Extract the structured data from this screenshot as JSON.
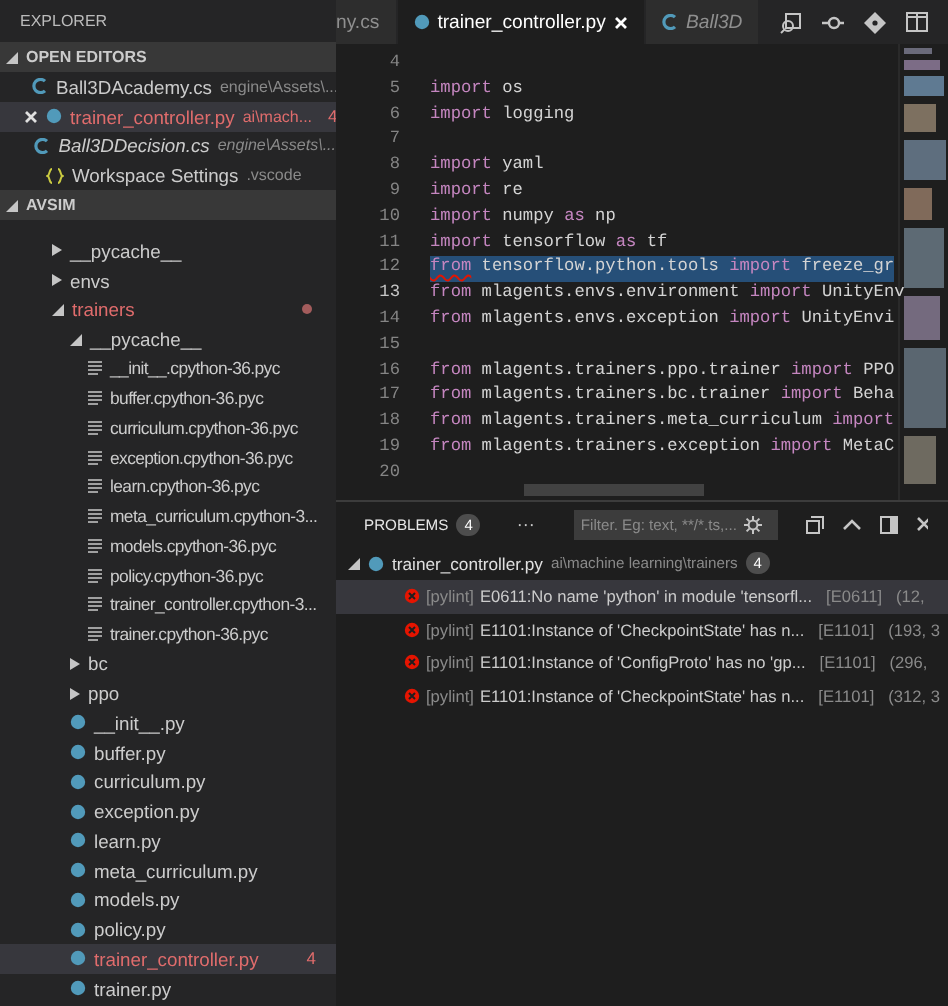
{
  "explorer": {
    "title": "EXPLORER",
    "open_editors": {
      "title": "OPEN EDITORS",
      "expanded": true,
      "items": [
        {
          "kind": "csharp",
          "name": "Ball3DAcademy.cs",
          "path": "engine\\Assets\\...",
          "preview": false,
          "selected": false
        },
        {
          "kind": "python",
          "name": "trainer_controller.py",
          "path": "ai\\mach...",
          "badge": "4",
          "preview": false,
          "selected": true
        },
        {
          "kind": "csharp",
          "name": "Ball3DDecision.cs",
          "path": "engine\\Assets\\...",
          "preview": true,
          "selected": false
        },
        {
          "kind": "settings",
          "name": "Workspace Settings",
          "path": ".vscode",
          "preview": false,
          "selected": false
        }
      ]
    },
    "folder": {
      "title": "AVSIM",
      "expanded": true,
      "items": [
        {
          "kind": "folder",
          "name": "__pycache__",
          "expanded": false,
          "error": false,
          "selected": false
        },
        {
          "kind": "folder",
          "name": "envs",
          "expanded": false,
          "error": false,
          "selected": false
        },
        {
          "kind": "folder",
          "name": "trainers",
          "expanded": true,
          "error": true,
          "selected": false,
          "children": [
            {
              "kind": "folder",
              "name": "__pycache__",
              "expanded": true,
              "error": false,
              "selected": false,
              "children": [
                {
                  "kind": "file",
                  "name": "__init__.cpython-36.pyc",
                  "error": false,
                  "selected": false
                },
                {
                  "kind": "file",
                  "name": "buffer.cpython-36.pyc",
                  "error": false,
                  "selected": false
                },
                {
                  "kind": "file",
                  "name": "curriculum.cpython-36.pyc",
                  "error": false,
                  "selected": false
                },
                {
                  "kind": "file",
                  "name": "exception.cpython-36.pyc",
                  "error": false,
                  "selected": false
                },
                {
                  "kind": "file",
                  "name": "learn.cpython-36.pyc",
                  "error": false,
                  "selected": false
                },
                {
                  "kind": "file",
                  "name": "meta_curriculum.cpython-3...",
                  "error": false,
                  "selected": false
                },
                {
                  "kind": "file",
                  "name": "models.cpython-36.pyc",
                  "error": false,
                  "selected": false
                },
                {
                  "kind": "file",
                  "name": "policy.cpython-36.pyc",
                  "error": false,
                  "selected": false
                },
                {
                  "kind": "file",
                  "name": "trainer_controller.cpython-3...",
                  "error": false,
                  "selected": false
                },
                {
                  "kind": "file",
                  "name": "trainer.cpython-36.pyc",
                  "error": false,
                  "selected": false
                }
              ]
            },
            {
              "kind": "folder",
              "name": "bc",
              "expanded": false,
              "error": false,
              "selected": false
            },
            {
              "kind": "folder",
              "name": "ppo",
              "expanded": false,
              "error": false,
              "selected": false
            },
            {
              "kind": "python",
              "name": "__init__.py",
              "error": false,
              "selected": false
            },
            {
              "kind": "python",
              "name": "buffer.py",
              "error": false,
              "selected": false
            },
            {
              "kind": "python",
              "name": "curriculum.py",
              "error": false,
              "selected": false
            },
            {
              "kind": "python",
              "name": "exception.py",
              "error": false,
              "selected": false
            },
            {
              "kind": "python",
              "name": "learn.py",
              "error": false,
              "selected": false
            },
            {
              "kind": "python",
              "name": "meta_curriculum.py",
              "error": false,
              "selected": false
            },
            {
              "kind": "python",
              "name": "models.py",
              "error": false,
              "selected": false
            },
            {
              "kind": "python",
              "name": "policy.py",
              "error": false,
              "selected": false
            },
            {
              "kind": "python",
              "name": "trainer_controller.py",
              "error": true,
              "badge": "4",
              "selected": true
            },
            {
              "kind": "python",
              "name": "trainer.py",
              "error": false,
              "selected": false
            }
          ]
        }
      ]
    }
  },
  "tabs": [
    {
      "kind": "plain",
      "label": "ny.cs",
      "selected": false,
      "preview": false
    },
    {
      "kind": "python",
      "label": "trainer_controller.py",
      "selected": true,
      "preview": false
    },
    {
      "kind": "csharp",
      "label": "Ball3D",
      "selected": false,
      "preview": true
    }
  ],
  "code": {
    "lines": [
      {
        "number": "4",
        "selected": false,
        "current": false
      },
      {
        "number": "5",
        "selected": false,
        "current": false,
        "tokens": [
          {
            "kind": "keyword",
            "text": "import"
          },
          {
            "kind": "plain",
            "text": " os"
          }
        ]
      },
      {
        "number": "6",
        "selected": false,
        "current": false,
        "tokens": [
          {
            "kind": "keyword",
            "text": "import"
          },
          {
            "kind": "plain",
            "text": " logging"
          }
        ]
      },
      {
        "number": "7",
        "selected": false,
        "current": false
      },
      {
        "number": "8",
        "selected": false,
        "current": false,
        "tokens": [
          {
            "kind": "keyword",
            "text": "import"
          },
          {
            "kind": "plain",
            "text": " yaml"
          }
        ]
      },
      {
        "number": "9",
        "selected": false,
        "current": false,
        "tokens": [
          {
            "kind": "keyword",
            "text": "import"
          },
          {
            "kind": "plain",
            "text": " re"
          }
        ]
      },
      {
        "number": "10",
        "selected": false,
        "current": false,
        "tokens": [
          {
            "kind": "keyword",
            "text": "import"
          },
          {
            "kind": "plain",
            "text": " numpy "
          },
          {
            "kind": "keyword",
            "text": "as"
          },
          {
            "kind": "plain",
            "text": " np"
          }
        ]
      },
      {
        "number": "11",
        "selected": false,
        "current": false,
        "tokens": [
          {
            "kind": "keyword",
            "text": "import"
          },
          {
            "kind": "plain",
            "text": " tensorflow "
          },
          {
            "kind": "keyword",
            "text": "as"
          },
          {
            "kind": "plain",
            "text": " tf"
          }
        ]
      },
      {
        "number": "12",
        "selected": true,
        "current": false,
        "tokens": [
          {
            "kind": "error",
            "text": "from"
          },
          {
            "kind": "plain",
            "text": " tensorflow.python.tools "
          },
          {
            "kind": "keyword",
            "text": "import"
          },
          {
            "kind": "plain",
            "text": " freeze_gr"
          }
        ]
      },
      {
        "number": "13",
        "selected": false,
        "current": true,
        "tokens": [
          {
            "kind": "keyword",
            "text": "from"
          },
          {
            "kind": "plain",
            "text": " mlagents.envs.environment "
          },
          {
            "kind": "keyword",
            "text": "import"
          },
          {
            "kind": "plain",
            "text": " UnityEnv"
          }
        ]
      },
      {
        "number": "14",
        "selected": false,
        "current": false,
        "tokens": [
          {
            "kind": "keyword",
            "text": "from"
          },
          {
            "kind": "plain",
            "text": " mlagents.envs.exception "
          },
          {
            "kind": "keyword",
            "text": "import"
          },
          {
            "kind": "plain",
            "text": " UnityEnvi"
          }
        ]
      },
      {
        "number": "15",
        "selected": false,
        "current": false
      },
      {
        "number": "16",
        "selected": false,
        "current": false,
        "tokens": [
          {
            "kind": "keyword",
            "text": "from"
          },
          {
            "kind": "plain",
            "text": " mlagents.trainers.ppo.trainer "
          },
          {
            "kind": "keyword",
            "text": "import"
          },
          {
            "kind": "plain",
            "text": " PPO"
          }
        ]
      },
      {
        "number": "17",
        "selected": false,
        "current": false,
        "tokens": [
          {
            "kind": "keyword",
            "text": "from"
          },
          {
            "kind": "plain",
            "text": " mlagents.trainers.bc.trainer "
          },
          {
            "kind": "keyword",
            "text": "import"
          },
          {
            "kind": "plain",
            "text": " Beha"
          }
        ]
      },
      {
        "number": "18",
        "selected": false,
        "current": false,
        "tokens": [
          {
            "kind": "keyword",
            "text": "from"
          },
          {
            "kind": "plain",
            "text": " mlagents.trainers.meta_curriculum "
          },
          {
            "kind": "keyword",
            "text": "import"
          }
        ]
      },
      {
        "number": "19",
        "selected": false,
        "current": false,
        "tokens": [
          {
            "kind": "keyword",
            "text": "from"
          },
          {
            "kind": "plain",
            "text": " mlagents.trainers.exception "
          },
          {
            "kind": "keyword",
            "text": "import"
          },
          {
            "kind": "plain",
            "text": " MetaC"
          }
        ]
      },
      {
        "number": "20",
        "selected": false,
        "current": false
      }
    ]
  },
  "problems": {
    "tabs": [
      {
        "label": "PROBLEMS",
        "count": "4",
        "selected": true
      }
    ],
    "more": "···",
    "filter": {
      "placeholder": "Filter. Eg: text, **/*.ts,..."
    },
    "file": {
      "name": "trainer_controller.py",
      "path": "ai\\machine learning\\trainers",
      "count": "4",
      "expanded": true
    },
    "messages": [
      {
        "source": "[pylint]",
        "text": "E0611:No name 'python' in module 'tensorfl...",
        "code": "[E0611]",
        "position": "(12,",
        "selected": true
      },
      {
        "source": "[pylint]",
        "text": "E1101:Instance of 'CheckpointState' has n...",
        "code": "[E1101]",
        "position": "(193, 3",
        "selected": false
      },
      {
        "source": "[pylint]",
        "text": "E1101:Instance of 'ConfigProto' has no 'gp...",
        "code": "[E1101]",
        "position": "(296,",
        "selected": false
      },
      {
        "source": "[pylint]",
        "text": "E1101:Instance of 'CheckpointState' has n...",
        "code": "[E1101]",
        "position": "(312, 3",
        "selected": false
      }
    ]
  }
}
